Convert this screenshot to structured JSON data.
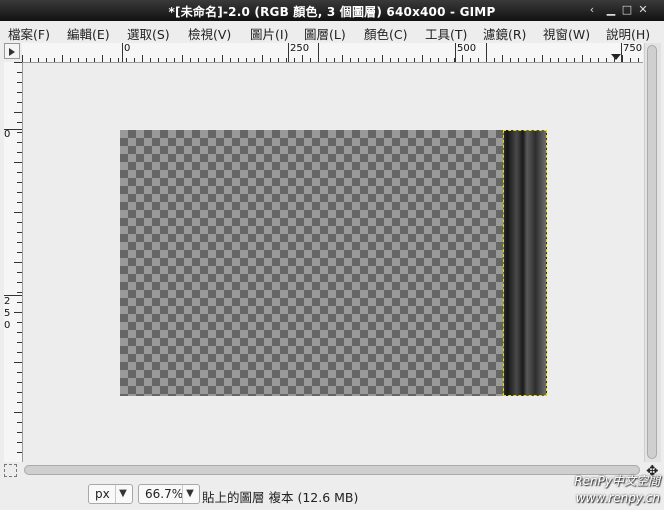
{
  "window": {
    "title": "*[未命名]-2.0 (RGB 顏色, 3 個圖層) 640x400 - GIMP",
    "buttons": [
      "‹",
      "▁",
      "□",
      "✕"
    ]
  },
  "menu": [
    "檔案(F)",
    "編輯(E)",
    "選取(S)",
    "檢視(V)",
    "圖片(I)",
    "圖層(L)",
    "顏色(C)",
    "工具(T)",
    "濾鏡(R)",
    "視窗(W)",
    "說明(H)"
  ],
  "ruler": {
    "h_labels": [
      "0",
      "250",
      "500",
      "750"
    ],
    "v_labels": [
      "0",
      "2",
      "5",
      "0"
    ]
  },
  "status": {
    "unit": "px",
    "zoom": "66.7%",
    "message": "貼上的圖層 複本 (12.6 MB)"
  },
  "watermark": {
    "line1": "RenPy中文空間",
    "line2": "www.renpy.cn"
  }
}
